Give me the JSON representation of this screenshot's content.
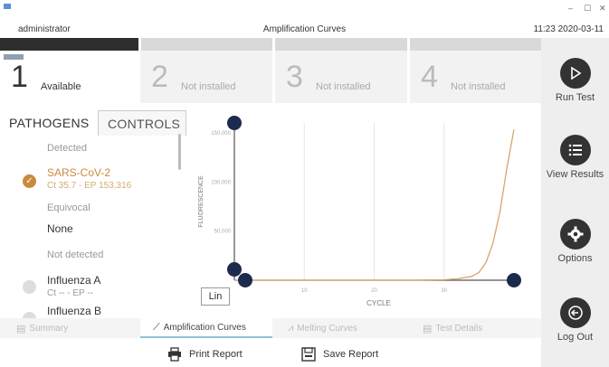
{
  "window": {
    "user": "administrator",
    "title": "Amplification Curves",
    "clock": "11:23 2020-03-11",
    "controls": [
      "–",
      "☐",
      "✕"
    ]
  },
  "slots": [
    {
      "number": "1",
      "label": "Available",
      "active": true
    },
    {
      "number": "2",
      "label": "Not installed",
      "active": false
    },
    {
      "number": "3",
      "label": "Not installed",
      "active": false
    },
    {
      "number": "4",
      "label": "Not installed",
      "active": false
    }
  ],
  "sidebar": {
    "run_test": "Run Test",
    "view_results": "View Results",
    "options": "Options",
    "log_out": "Log Out"
  },
  "tabs": {
    "pathogens": "PATHOGENS",
    "controls": "CONTROLS"
  },
  "results": {
    "detected_label": "Detected",
    "detected_name": "SARS-CoV-2",
    "detected_values": "Ct 35.7 - EP 153,316",
    "equivocal_label": "Equivocal",
    "equivocal_value": "None",
    "not_detected_label": "Not detected",
    "item1_name": "Influenza A",
    "item1_values": "Ct -- - EP --",
    "item2_name": "Influenza B"
  },
  "chart_data": {
    "type": "line",
    "xlabel": "CYCLE",
    "ylabel": "FLUORESCENCE",
    "x_ticks": [
      "10",
      "20",
      "30"
    ],
    "y_ticks": [
      "150,000",
      "100,000",
      "50,000"
    ],
    "xlim": [
      0,
      40
    ],
    "ylim": [
      0,
      160000
    ],
    "series": [
      {
        "color": "#d7a66f",
        "x": [
          0,
          5,
          10,
          15,
          20,
          25,
          30,
          32,
          34,
          35,
          36,
          37,
          38,
          39,
          40
        ],
        "y": [
          0,
          0,
          0,
          0,
          0,
          0,
          500,
          1500,
          4000,
          8000,
          18000,
          38000,
          70000,
          115000,
          153316
        ]
      }
    ],
    "scale": "Lin",
    "colors": {
      "axis": "#555555",
      "handle": "#1c2a4d",
      "grid": "#e6e6e6"
    }
  },
  "bottom_tabs": [
    {
      "label": "Summary",
      "active": false
    },
    {
      "label": "Amplification Curves",
      "active": true
    },
    {
      "label": "Melting Curves",
      "active": false
    },
    {
      "label": "Test Details",
      "active": false
    }
  ],
  "actions": {
    "print": "Print Report",
    "save": "Save Report"
  }
}
